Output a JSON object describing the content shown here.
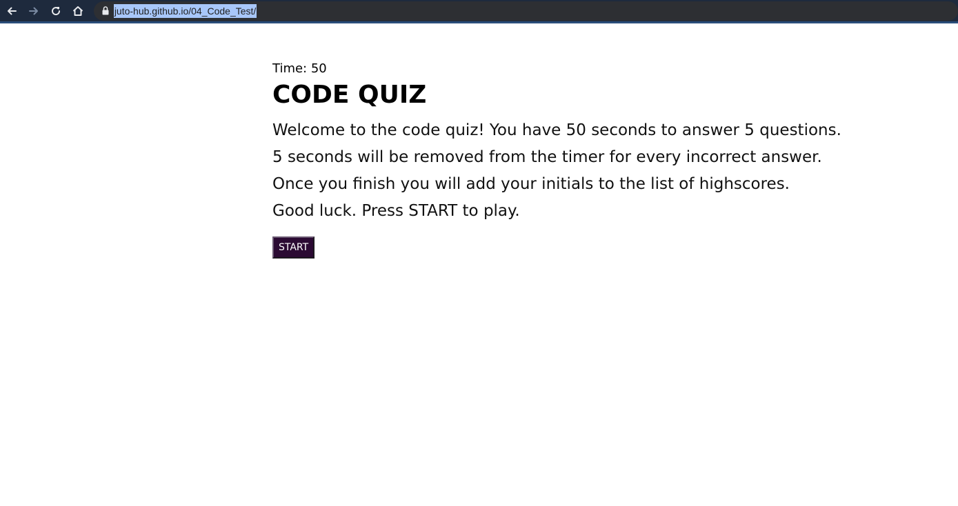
{
  "browser": {
    "url": "juto-hub.github.io/04_Code_Test/",
    "icons": [
      "back-arrow-icon",
      "forward-arrow-icon",
      "reload-icon",
      "home-icon",
      "lock-icon"
    ]
  },
  "quiz": {
    "timer_label": "Time: ",
    "timer_value": "50",
    "title": "CODE QUIZ",
    "intro_lines": [
      "Welcome to the code quiz! You have 50 seconds to answer 5 questions.",
      "5 seconds will be removed from the timer for every incorrect answer.",
      "Once you finish you will add your initials to the list of highscores.",
      "Good luck. Press START to play."
    ],
    "start_label": "START"
  },
  "colors": {
    "browser_bar": "#1e2a3d",
    "start_button_bg": "#2b0a33"
  }
}
